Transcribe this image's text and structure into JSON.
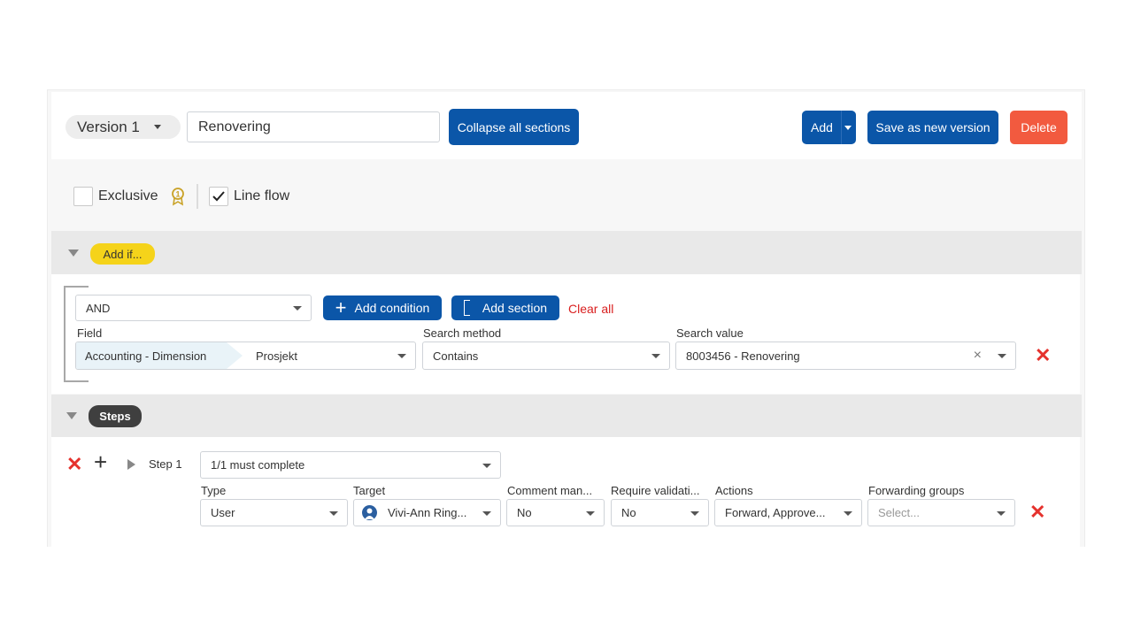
{
  "toolbar": {
    "version_label": "Version 1",
    "name_value": "Renovering",
    "collapse_label": "Collapse all sections",
    "add_label": "Add",
    "save_new_label": "Save as new version",
    "delete_label": "Delete"
  },
  "options": {
    "exclusive_label": "Exclusive",
    "exclusive_checked": false,
    "lineflow_label": "Line flow",
    "lineflow_checked": true
  },
  "conditions": {
    "section_label": "Add if...",
    "operator_value": "AND",
    "add_condition_label": "Add condition",
    "add_section_label": "Add section",
    "clear_all_label": "Clear all",
    "field_label": "Field",
    "field_category": "Accounting - Dimension",
    "field_value": "Prosjekt",
    "method_label": "Search method",
    "method_value": "Contains",
    "search_value_label": "Search value",
    "search_value": "8003456 - Renovering"
  },
  "steps": {
    "section_label": "Steps",
    "step_label": "Step 1",
    "completion_value": "1/1 must complete",
    "type_label": "Type",
    "type_value": "User",
    "target_label": "Target",
    "target_value": "Vivi-Ann Ring...",
    "comment_label": "Comment man...",
    "comment_value": "No",
    "validation_label": "Require validati...",
    "validation_value": "No",
    "actions_label": "Actions",
    "actions_value": "Forward, Approve...",
    "forwarding_label": "Forwarding groups",
    "forwarding_placeholder": "Select..."
  },
  "colors": {
    "primary": "#0b56a8",
    "danger": "#f25a3f",
    "condition_pill": "#f5d31a",
    "steps_pill": "#3f3f3f",
    "remove_icon": "#e5322d"
  }
}
